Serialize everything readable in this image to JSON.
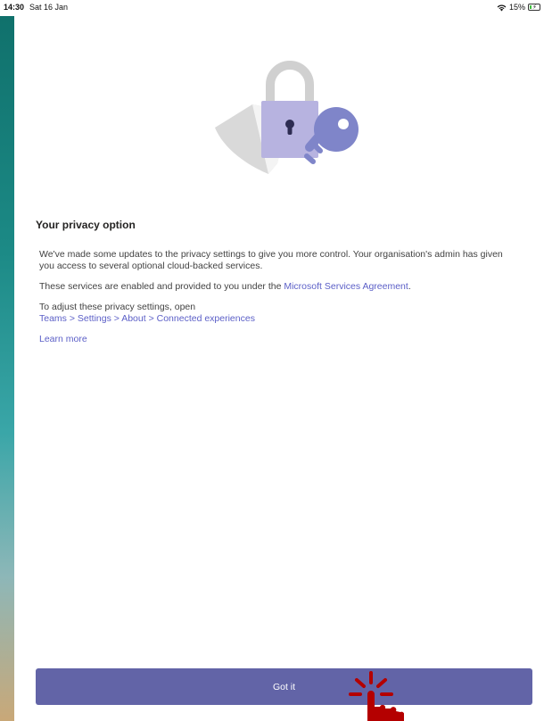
{
  "status_bar": {
    "time": "14:30",
    "date": "Sat 16 Jan",
    "battery_percent": "15%",
    "battery_level": 0.15,
    "icons": [
      "wifi-icon",
      "battery-charging-icon"
    ]
  },
  "dialog": {
    "illustration": "shield-lock-key-icon",
    "title": "Your privacy option",
    "paragraph1": "We've made some updates to the privacy settings to give you more control. Your organisation's admin has given you access to several optional cloud-backed services.",
    "paragraph2_prefix": "These services are enabled and provided to you under the ",
    "paragraph2_link": "Microsoft Services Agreement",
    "paragraph2_suffix": ".",
    "paragraph3_prefix": "To adjust these privacy settings, open",
    "paragraph3_path": "Teams > Settings > About > Connected experiences",
    "learn_more": "Learn more",
    "button_label": "Got it"
  },
  "colors": {
    "accent": "#6264a7",
    "link": "#5b5fc7",
    "lock_body": "#b7b3e0",
    "key": "#7f85c9",
    "tap_indicator": "#b40000"
  }
}
